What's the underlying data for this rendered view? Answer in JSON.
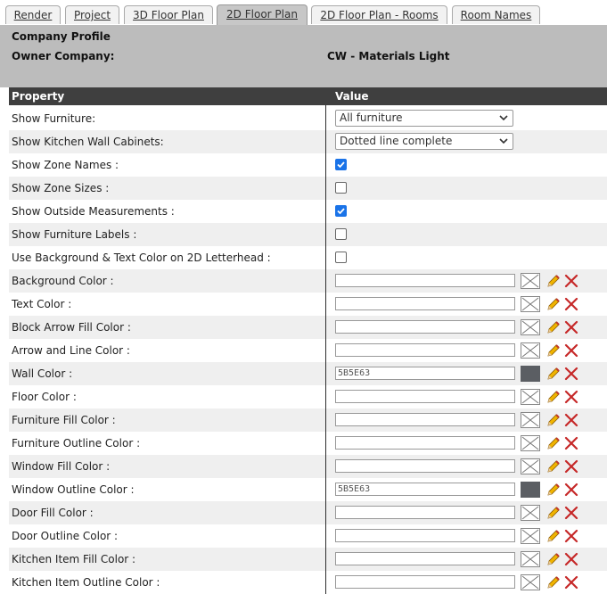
{
  "tabs": [
    {
      "label": "Render"
    },
    {
      "label": "Project"
    },
    {
      "label": "3D Floor Plan"
    },
    {
      "label": "2D Floor Plan"
    },
    {
      "label": "2D Floor Plan - Rooms"
    },
    {
      "label": "Room Names"
    }
  ],
  "active_tab": "2D Floor Plan",
  "header": {
    "title": "Company Profile",
    "owner_label": "Owner Company:",
    "owner_value": "CW - Materials Light"
  },
  "table": {
    "col_property": "Property",
    "col_value": "Value"
  },
  "selects": [
    {
      "label": "Show Furniture:",
      "value": "All furniture"
    },
    {
      "label": "Show Kitchen Wall Cabinets:",
      "value": "Dotted line complete"
    }
  ],
  "checkboxes": [
    {
      "label": "Show Zone Names :",
      "checked": true
    },
    {
      "label": "Show Zone Sizes :",
      "checked": false
    },
    {
      "label": "Show Outside Measurements :",
      "checked": true
    },
    {
      "label": "Show Furniture Labels :",
      "checked": false
    },
    {
      "label": "Use Background & Text Color on 2D Letterhead :",
      "checked": false
    }
  ],
  "colors": [
    {
      "label": "Background Color :",
      "value": "",
      "swatch": ""
    },
    {
      "label": "Text Color :",
      "value": "",
      "swatch": ""
    },
    {
      "label": "Block Arrow Fill Color :",
      "value": "",
      "swatch": ""
    },
    {
      "label": "Arrow and Line Color :",
      "value": "",
      "swatch": ""
    },
    {
      "label": "Wall Color :",
      "value": "5B5E63",
      "swatch": "#5B5E63"
    },
    {
      "label": "Floor Color :",
      "value": "",
      "swatch": ""
    },
    {
      "label": "Furniture Fill Color :",
      "value": "",
      "swatch": ""
    },
    {
      "label": "Furniture Outline Color :",
      "value": "",
      "swatch": ""
    },
    {
      "label": "Window Fill Color :",
      "value": "",
      "swatch": ""
    },
    {
      "label": "Window Outline Color :",
      "value": "5B5E63",
      "swatch": "#5B5E63"
    },
    {
      "label": "Door Fill Color :",
      "value": "",
      "swatch": ""
    },
    {
      "label": "Door Outline Color :",
      "value": "",
      "swatch": ""
    },
    {
      "label": "Kitchen Item Fill Color :",
      "value": "",
      "swatch": ""
    },
    {
      "label": "Kitchen Item Outline Color :",
      "value": "",
      "swatch": ""
    }
  ],
  "icons": {
    "select_arrow": "chevron-down-icon",
    "empty_swatch": "empty-swatch-icon",
    "edit": "pencil-icon",
    "clear": "delete-x-icon"
  },
  "palette": {
    "header_bg": "#bcbcbc",
    "table_head_bg": "#3f3f3f",
    "alt_row_bg": "#efefef",
    "checkbox_on": "#1a73e8",
    "delete_red": "#c62828"
  }
}
